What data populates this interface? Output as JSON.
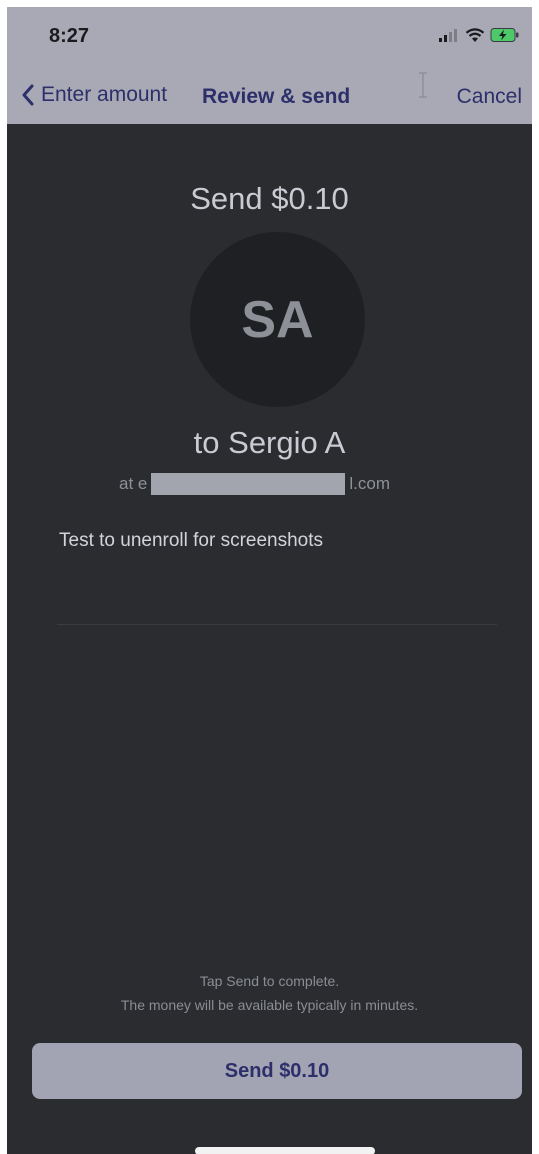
{
  "status_bar": {
    "time": "8:27"
  },
  "nav": {
    "back_label": "Enter amount",
    "title": "Review & send",
    "cancel_label": "Cancel"
  },
  "review": {
    "send_title": "Send $0.10",
    "avatar_initials": "SA",
    "recipient_name": "to Sergio A",
    "email_prefix": "at e",
    "email_suffix": "l.com",
    "memo": "Test to unenroll for screenshots"
  },
  "footer": {
    "line1": "Tap Send to complete.",
    "line2": "The money will be available typically in minutes.",
    "send_button_label": "Send $0.10"
  },
  "colors": {
    "background": "#2a2c30",
    "header": "#a8a9b5",
    "accent": "#2d2f6a",
    "button": "#a2a3b3"
  },
  "icons": [
    "signal-icon",
    "wifi-icon",
    "battery-charging-icon",
    "chevron-left-icon",
    "text-cursor-icon"
  ]
}
